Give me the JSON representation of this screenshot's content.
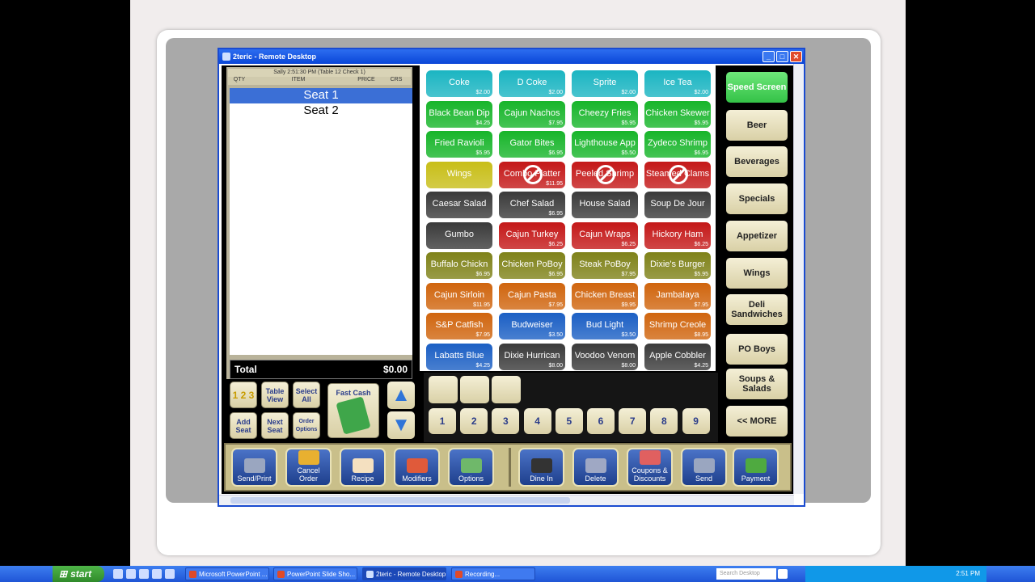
{
  "window": {
    "title": "2teric - Remote Desktop"
  },
  "order": {
    "header": "Sally   2:51:30 PM  (Table 12 Check 1)",
    "columns": [
      "QTY",
      "ITEM",
      "PRICE",
      "CRS"
    ],
    "seats": [
      "Seat 1",
      "Seat 2"
    ],
    "total_label": "Total",
    "total_value": "$0.00"
  },
  "side_buttons": {
    "table_view": "Table View",
    "select_all": "Select All",
    "fast_cash": "Fast Cash",
    "add_seat": "Add Seat",
    "next_seat": "Next Seat",
    "order_options": "Order Options",
    "qty_icon": "1 2 3"
  },
  "menu_items": [
    {
      "name": "Coke",
      "price": "$2.00",
      "color": "#1bb5c2"
    },
    {
      "name": "D Coke",
      "price": "$2.00",
      "color": "#1bb5c2"
    },
    {
      "name": "Sprite",
      "price": "$2.00",
      "color": "#1bb5c2"
    },
    {
      "name": "Ice Tea",
      "price": "$2.00",
      "color": "#1bb5c2"
    },
    {
      "name": "Black Bean Dip",
      "price": "$4.25",
      "color": "#17b52a"
    },
    {
      "name": "Cajun Nachos",
      "price": "$7.95",
      "color": "#17b52a"
    },
    {
      "name": "Cheezy Fries",
      "price": "$5.95",
      "color": "#17b52a"
    },
    {
      "name": "Chicken Skewer",
      "price": "$5.95",
      "color": "#17b52a"
    },
    {
      "name": "Fried Ravioli",
      "price": "$5.95",
      "color": "#17b52a"
    },
    {
      "name": "Gator Bites",
      "price": "$6.95",
      "color": "#17b52a"
    },
    {
      "name": "Lighthouse App",
      "price": "$5.50",
      "color": "#17b52a"
    },
    {
      "name": "Zydeco Shrimp",
      "price": "$6.95",
      "color": "#17b52a"
    },
    {
      "name": "Wings",
      "price": "",
      "color": "#c8be18"
    },
    {
      "name": "Combo Platter",
      "price": "$11.95",
      "color": "#c41818",
      "blocked": true
    },
    {
      "name": "Peeled Shrimp",
      "price": "",
      "color": "#c41818",
      "blocked": true
    },
    {
      "name": "Steamed Clams",
      "price": "",
      "color": "#c41818",
      "blocked": true
    },
    {
      "name": "Caesar Salad",
      "price": "",
      "color": "#3a3a3a"
    },
    {
      "name": "Chef Salad",
      "price": "$6.95",
      "color": "#3a3a3a"
    },
    {
      "name": "House Salad",
      "price": "",
      "color": "#3a3a3a"
    },
    {
      "name": "Soup De Jour",
      "price": "",
      "color": "#3a3a3a"
    },
    {
      "name": "Gumbo",
      "price": "",
      "color": "#3a3a3a"
    },
    {
      "name": "Cajun Turkey",
      "price": "$6.25",
      "color": "#c41818"
    },
    {
      "name": "Cajun Wraps",
      "price": "$6.25",
      "color": "#c41818"
    },
    {
      "name": "Hickory Ham",
      "price": "$6.25",
      "color": "#c41818"
    },
    {
      "name": "Buffalo Chickn",
      "price": "$6.95",
      "color": "#7f8219"
    },
    {
      "name": "Chicken PoBoy",
      "price": "$6.95",
      "color": "#7f8219"
    },
    {
      "name": "Steak PoBoy",
      "price": "$7.95",
      "color": "#7f8219"
    },
    {
      "name": "Dixie's Burger",
      "price": "$5.95",
      "color": "#7f8219"
    },
    {
      "name": "Cajun Sirloin",
      "price": "$11.95",
      "color": "#d0650e"
    },
    {
      "name": "Cajun Pasta",
      "price": "$7.95",
      "color": "#d0650e"
    },
    {
      "name": "Chicken Breast",
      "price": "$9.95",
      "color": "#d0650e"
    },
    {
      "name": "Jambalaya",
      "price": "$7.95",
      "color": "#d0650e"
    },
    {
      "name": "S&P Catfish",
      "price": "$7.95",
      "color": "#d0650e"
    },
    {
      "name": "Budweiser",
      "price": "$3.50",
      "color": "#1b5fc4"
    },
    {
      "name": "Bud Light",
      "price": "$3.50",
      "color": "#1b5fc4"
    },
    {
      "name": "Shrimp Creole",
      "price": "$8.95",
      "color": "#d0650e"
    },
    {
      "name": "Labatts Blue",
      "price": "$4.25",
      "color": "#1b5fc4"
    },
    {
      "name": "Dixie Hurrican",
      "price": "$8.00",
      "color": "#3a3a3a"
    },
    {
      "name": "Voodoo Venom",
      "price": "$8.00",
      "color": "#3a3a3a"
    },
    {
      "name": "Apple Cobbler",
      "price": "$4.25",
      "color": "#3a3a3a"
    }
  ],
  "categories": [
    "Speed Screen",
    "Beer",
    "Beverages",
    "Specials",
    "Appetizer",
    "Wings",
    "Deli Sandwiches",
    "PO Boys",
    "Soups & Salads",
    "<< MORE"
  ],
  "numpad": [
    "1",
    "2",
    "3",
    "4",
    "5",
    "6",
    "7",
    "8",
    "9"
  ],
  "actions": [
    {
      "label": "Send/Print",
      "color": "#9aa6c0"
    },
    {
      "label": "Cancel Order",
      "color": "#e8b030"
    },
    {
      "label": "Recipe",
      "color": "#f4e0c0"
    },
    {
      "label": "Modifiers",
      "color": "#e05a3a"
    },
    {
      "label": "Options",
      "color": "#6fb86a"
    },
    {
      "label": "Dine In",
      "color": "#333333"
    },
    {
      "label": "Delete",
      "color": "#9fa8c4"
    },
    {
      "label": "Coupons & Discounts",
      "color": "#e06060"
    },
    {
      "label": "Send",
      "color": "#9aa6c0"
    },
    {
      "label": "Payment",
      "color": "#4faa40"
    }
  ],
  "taskbar": {
    "start": "start",
    "tasks": [
      "Microsoft PowerPoint ...",
      "PowerPoint Slide Sho...",
      "2teric - Remote Desktop",
      "Recording..."
    ],
    "search_placeholder": "Search Desktop",
    "clock": "2:51 PM"
  }
}
